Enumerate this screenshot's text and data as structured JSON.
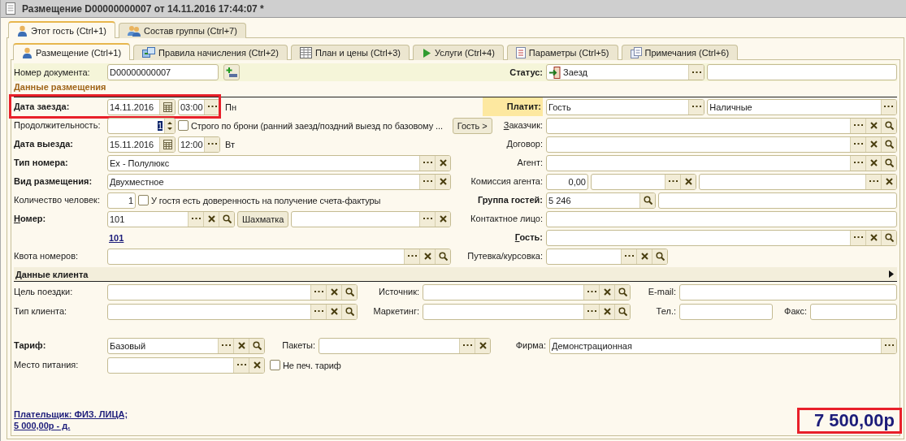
{
  "window": {
    "title": "Размещение D00000000007 от 14.11.2016 17:44:07 *"
  },
  "outer_tabs": [
    {
      "label": "Этот гость (Ctrl+1)",
      "selected": true
    },
    {
      "label": "Состав группы (Ctrl+7)",
      "selected": false
    }
  ],
  "inner_tabs": [
    {
      "label": "Размещение (Ctrl+1)",
      "selected": true
    },
    {
      "label": "Правила начисления (Ctrl+2)",
      "selected": false
    },
    {
      "label": "План и цены (Ctrl+3)",
      "selected": false
    },
    {
      "label": "Услуги (Ctrl+4)",
      "selected": false
    },
    {
      "label": "Параметры (Ctrl+5)",
      "selected": false
    },
    {
      "label": "Примечания (Ctrl+6)",
      "selected": false
    }
  ],
  "document": {
    "label": "Номер документа:",
    "value": "D00000000007"
  },
  "status": {
    "label": "Статус:",
    "value": "Заезд"
  },
  "placement": {
    "title": "Данные размещения"
  },
  "left": [
    {
      "label": {
        "text": "Дата заезда:",
        "bold": true,
        "accelerator": false
      },
      "controls": [
        {
          "kind": "field",
          "value": "14.11.2016",
          "buttons": [
            {
              "kind": "calendar"
            }
          ]
        },
        {
          "kind": "field",
          "value": "03:00",
          "buttons": [
            {
              "kind": "select"
            }
          ]
        },
        {
          "kind": "text",
          "value": "Пн"
        }
      ]
    },
    {
      "label": {
        "text": "Продолжительность:",
        "bold": false,
        "accelerator": false
      },
      "controls": [
        {
          "kind": "spin",
          "value": "1",
          "focused": true
        },
        {
          "kind": "checkbox",
          "label": "Строго по брони (ранний заезд/поздний выезд по базовому ...",
          "checked": false
        }
      ]
    },
    {
      "label": {
        "text": "Дата выезда:",
        "bold": true,
        "accelerator": false
      },
      "controls": [
        {
          "kind": "field",
          "value": "15.11.2016",
          "buttons": [
            {
              "kind": "calendar"
            }
          ]
        },
        {
          "kind": "field",
          "value": "12:00",
          "buttons": [
            {
              "kind": "select"
            }
          ]
        },
        {
          "kind": "text",
          "value": "Вт"
        }
      ]
    },
    {
      "label": {
        "text": "Тип номера:",
        "bold": true,
        "accelerator": false
      },
      "controls": [
        {
          "kind": "field",
          "value": "Ex - Полулюкс",
          "buttons": [
            {
              "kind": "select"
            },
            {
              "kind": "clear"
            }
          ]
        }
      ]
    },
    {
      "label": {
        "text": "Вид размещения:",
        "bold": true,
        "accelerator": false
      },
      "controls": [
        {
          "kind": "field",
          "value": "Двухместное",
          "buttons": [
            {
              "kind": "select"
            },
            {
              "kind": "clear"
            }
          ]
        }
      ]
    },
    {
      "label": {
        "text": "Количество человек:",
        "bold": false,
        "accelerator": false
      },
      "controls": [
        {
          "kind": "number",
          "value": "1"
        },
        {
          "kind": "checkbox",
          "label": "У гостя есть доверенность на получение счета-фактуры",
          "checked": false
        }
      ]
    },
    {
      "label": {
        "text": "Номер:",
        "bold": true,
        "accelerator": true
      },
      "controls": [
        {
          "kind": "field",
          "value": "101",
          "buttons": [
            {
              "kind": "select"
            },
            {
              "kind": "clear"
            },
            {
              "kind": "search"
            }
          ]
        },
        {
          "kind": "button",
          "label": "Шахматка"
        },
        {
          "kind": "field",
          "buttons": [
            {
              "kind": "select"
            },
            {
              "kind": "clear"
            }
          ]
        }
      ]
    },
    {
      "controls": [
        {
          "kind": "link",
          "value": "101"
        }
      ]
    },
    {
      "label": {
        "text": "Квота номеров:",
        "bold": false,
        "accelerator": false
      },
      "controls": [
        {
          "kind": "field",
          "buttons": [
            {
              "kind": "select"
            },
            {
              "kind": "clear"
            },
            {
              "kind": "search"
            }
          ]
        }
      ]
    }
  ],
  "right": [
    {
      "label": {
        "text": "Платит:",
        "bold": true,
        "accelerator": false,
        "highlighted": true
      },
      "controls": [
        {
          "kind": "field",
          "value": "Гость",
          "buttons": [
            {
              "kind": "select"
            }
          ]
        },
        {
          "kind": "field",
          "value": "Наличные",
          "buttons": [
            {
              "kind": "select"
            }
          ]
        }
      ]
    },
    {
      "button": {
        "label": "Гость >"
      },
      "label": {
        "text": "Заказчик:",
        "bold": false,
        "accelerator": true,
        "highlighted": false
      },
      "controls": [
        {
          "kind": "field",
          "buttons": [
            {
              "kind": "select"
            },
            {
              "kind": "clear"
            },
            {
              "kind": "search"
            }
          ]
        }
      ]
    },
    {
      "label": {
        "text": "Договор:",
        "bold": false,
        "accelerator": false,
        "highlighted": false
      },
      "controls": [
        {
          "kind": "field",
          "buttons": [
            {
              "kind": "select"
            },
            {
              "kind": "clear"
            },
            {
              "kind": "search"
            }
          ]
        }
      ]
    },
    {
      "label": {
        "text": "Агент:",
        "bold": false,
        "accelerator": false,
        "highlighted": false
      },
      "controls": [
        {
          "kind": "field",
          "buttons": [
            {
              "kind": "select"
            },
            {
              "kind": "clear"
            },
            {
              "kind": "search"
            }
          ]
        }
      ]
    },
    {
      "label": {
        "text": "Комиссия агента:",
        "bold": false,
        "accelerator": false,
        "highlighted": false
      },
      "controls": [
        {
          "kind": "number",
          "value": "0,00"
        },
        {
          "kind": "field",
          "buttons": [
            {
              "kind": "select"
            },
            {
              "kind": "clear"
            }
          ]
        },
        {
          "kind": "field",
          "buttons": [
            {
              "kind": "select"
            },
            {
              "kind": "clear"
            }
          ]
        }
      ]
    },
    {
      "label": {
        "text": "Группа гостей:",
        "bold": true,
        "accelerator": false,
        "highlighted": false
      },
      "controls": [
        {
          "kind": "field",
          "value": "5 246",
          "buttons": [
            {
              "kind": "search"
            }
          ]
        },
        {
          "kind": "field"
        }
      ]
    },
    {
      "label": {
        "text": "Контактное лицо:",
        "bold": false,
        "accelerator": false,
        "highlighted": false
      },
      "controls": [
        {
          "kind": "field"
        }
      ]
    },
    {
      "label": {
        "text": "Гость:",
        "bold": true,
        "accelerator": true,
        "highlighted": false
      },
      "controls": [
        {
          "kind": "field",
          "buttons": [
            {
              "kind": "select"
            },
            {
              "kind": "clear"
            },
            {
              "kind": "search"
            }
          ]
        }
      ]
    },
    {
      "label": {
        "text": "Путевка/курсовка:",
        "bold": false,
        "accelerator": false,
        "highlighted": false
      },
      "controls": [
        {
          "kind": "field",
          "buttons": [
            {
              "kind": "select"
            },
            {
              "kind": "clear"
            },
            {
              "kind": "search"
            }
          ]
        }
      ]
    }
  ],
  "client": {
    "title": "Данные клиента",
    "rows": [
      {
        "items": [
          {
            "label": {
              "text": "Цель поездки:",
              "bold": false
            },
            "control": {
              "kind": "field",
              "buttons": [
                {
                  "kind": "select"
                },
                {
                  "kind": "clear"
                },
                {
                  "kind": "search"
                }
              ]
            }
          },
          {
            "label": {
              "text": "Источник:",
              "bold": false
            },
            "control": {
              "kind": "field",
              "buttons": [
                {
                  "kind": "select"
                },
                {
                  "kind": "clear"
                },
                {
                  "kind": "search"
                }
              ]
            }
          },
          {
            "label": {
              "text": "E-mail:",
              "bold": false
            },
            "control": {
              "kind": "field"
            }
          }
        ]
      },
      {
        "items": [
          {
            "label": {
              "text": "Тип клиента:",
              "bold": false
            },
            "control": {
              "kind": "field",
              "buttons": [
                {
                  "kind": "select"
                },
                {
                  "kind": "clear"
                },
                {
                  "kind": "search"
                }
              ]
            }
          },
          {
            "label": {
              "text": "Маркетинг:",
              "bold": false
            },
            "control": {
              "kind": "field",
              "buttons": [
                {
                  "kind": "select"
                },
                {
                  "kind": "clear"
                },
                {
                  "kind": "search"
                }
              ]
            }
          },
          {
            "label": {
              "text": "Тел.:",
              "bold": false
            },
            "control": {
              "kind": "field"
            }
          },
          {
            "label": {
              "text": "Факс:",
              "bold": false
            },
            "control": {
              "kind": "field"
            }
          }
        ]
      }
    ]
  },
  "tariff": {
    "rows": [
      {
        "items": [
          {
            "label": {
              "text": "Тариф:",
              "bold": true
            },
            "control": {
              "kind": "field",
              "value": "Базовый",
              "buttons": [
                {
                  "kind": "select"
                },
                {
                  "kind": "clear"
                },
                {
                  "kind": "search"
                }
              ]
            }
          },
          {
            "label": {
              "text": "Пакеты:",
              "bold": false
            },
            "control": {
              "kind": "field",
              "buttons": [
                {
                  "kind": "select"
                },
                {
                  "kind": "clear"
                }
              ]
            }
          },
          {
            "label": {
              "text": "Фирма:",
              "bold": false
            },
            "control": {
              "kind": "field",
              "value": "Демонстрационная",
              "buttons": [
                {
                  "kind": "select"
                }
              ]
            }
          }
        ]
      },
      {
        "items": [
          {
            "label": {
              "text": "Место питания:",
              "bold": false
            },
            "control": {
              "kind": "field",
              "buttons": [
                {
                  "kind": "select"
                },
                {
                  "kind": "clear"
                }
              ]
            }
          },
          {
            "control": {
              "kind": "checkbox",
              "label": "Не печ. тариф",
              "checked": false
            }
          }
        ]
      }
    ]
  },
  "payer": {
    "lines": [
      "Плательщик: ФИЗ. ЛИЦА;",
      "5 000,00р - д."
    ]
  },
  "total": "7 500,00р"
}
